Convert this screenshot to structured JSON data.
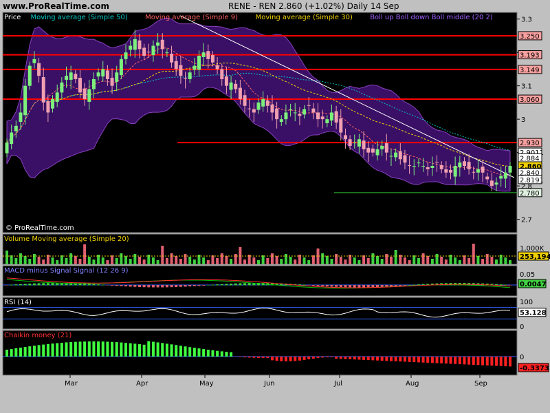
{
  "header": {
    "site": "www.ProRealTime.com",
    "title": "RENE - REN    2.860 (+1.02%)    Daily  14 Sep"
  },
  "watermark": "© ProRealTime.com",
  "colors": {
    "background": "#000000",
    "frame": "#c0c0c0",
    "up_candle": "#7cf07c",
    "down_candle": "#f0a0b0",
    "boll_fill": "#3a1066",
    "boll_line": "#8a40c0",
    "ma50": "#00c8c8",
    "ma9": "#ff6060",
    "ma30": "#f0d000",
    "hline": "#ff0000",
    "volume_up": "#40d040",
    "volume_down": "#e06070",
    "chaikin_up": "#40ff40",
    "chaikin_down": "#ff2020"
  },
  "chart_data": [
    {
      "type": "candlestick",
      "panel": "price",
      "legend": [
        "Price",
        "Moving average (Simple 50)",
        "Moving average (Simple 9)",
        "Moving average (Simple 30)",
        "Boll up Boll down Boll middle (20 2)"
      ],
      "ylim": [
        2.66,
        3.32
      ],
      "y_ticks": [
        "3.3",
        "3.2",
        "3.1",
        "3",
        "2.9",
        "2.8",
        "2.7"
      ],
      "x_labels": [
        "Mar",
        "Apr",
        "May",
        "Jun",
        "Jul",
        "Aug",
        "Sep"
      ],
      "price_levels": [
        {
          "value": 3.25,
          "label": "3.250"
        },
        {
          "value": 3.193,
          "label": "3.193"
        },
        {
          "value": 3.149,
          "label": "3.149"
        },
        {
          "value": 3.06,
          "label": "3.060"
        },
        {
          "value": 2.93,
          "label": "2.930"
        },
        {
          "value": 2.78,
          "label": "2.780"
        }
      ],
      "right_labels": [
        {
          "value": 2.9011,
          "label": "2.9011"
        },
        {
          "value": 2.884,
          "label": "2.884"
        },
        {
          "value": 2.86,
          "label": "2.860"
        },
        {
          "value": 2.84,
          "label": "2.840"
        },
        {
          "value": 2.8191,
          "label": "2.8191"
        }
      ],
      "closes": [
        2.93,
        2.96,
        2.98,
        3.02,
        3.1,
        3.16,
        3.18,
        3.13,
        3.05,
        3.02,
        3.06,
        3.08,
        3.11,
        3.13,
        3.14,
        3.12,
        3.08,
        3.06,
        3.09,
        3.12,
        3.14,
        3.15,
        3.12,
        3.1,
        3.14,
        3.18,
        3.2,
        3.22,
        3.24,
        3.21,
        3.19,
        3.2,
        3.22,
        3.23,
        3.21,
        3.2,
        3.17,
        3.15,
        3.13,
        3.12,
        3.14,
        3.16,
        3.19,
        3.2,
        3.18,
        3.17,
        3.15,
        3.12,
        3.1,
        3.11,
        3.09,
        3.06,
        3.04,
        3.03,
        3.02,
        3.05,
        3.06,
        3.04,
        3.02,
        3.0,
        3.0,
        3.02,
        3.03,
        3.02,
        3.01,
        3.03,
        3.04,
        3.02,
        3.0,
        3.0,
        3.0,
        3.02,
        2.99,
        2.96,
        2.94,
        2.92,
        2.93,
        2.94,
        2.91,
        2.9,
        2.9,
        2.91,
        2.92,
        2.9,
        2.89,
        2.9,
        2.88,
        2.87,
        2.86,
        2.86,
        2.87,
        2.86,
        2.85,
        2.86,
        2.87,
        2.85,
        2.84,
        2.84,
        2.86,
        2.87,
        2.86,
        2.85,
        2.84,
        2.85,
        2.84,
        2.82,
        2.8,
        2.81,
        2.83,
        2.84,
        2.86
      ]
    },
    {
      "type": "bar",
      "panel": "volume",
      "legend": [
        "Volume",
        "Moving average (Simple 20)"
      ],
      "y_ticks": [
        "1,000K"
      ],
      "current_label": "253,194"
    },
    {
      "type": "line",
      "panel": "macd",
      "legend": [
        "MACD minus Signal Signal (12 26 9)"
      ],
      "y_ticks": [
        "0.05",
        "0"
      ],
      "current_label": "0.0047"
    },
    {
      "type": "line",
      "panel": "rsi",
      "legend": [
        "RSI (14)"
      ],
      "ylim": [
        0,
        100
      ],
      "y_ticks": [
        "100",
        "50",
        "0"
      ],
      "current_label": "53.128"
    },
    {
      "type": "bar",
      "panel": "chaikin",
      "legend": [
        "Chaikin money (21)"
      ],
      "y_ticks": [
        "0"
      ],
      "current_label": "-0.3373"
    }
  ]
}
